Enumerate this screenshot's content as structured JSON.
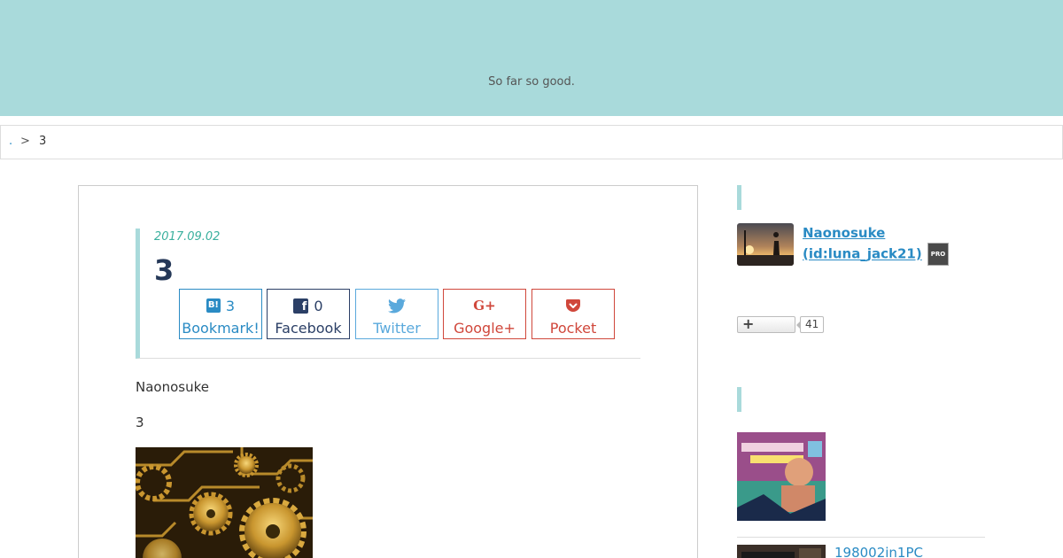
{
  "header": {
    "tagline": "So far so good."
  },
  "breadcrumb": {
    "home_label": ".",
    "separator": ">",
    "current": "3"
  },
  "entry": {
    "date": "2017.09.02",
    "title": "3",
    "author": "Naonosuke",
    "body_text": "3",
    "share": {
      "hatena": {
        "icon": "hatena-bookmark-icon",
        "count": "3",
        "label": "Bookmark!"
      },
      "facebook": {
        "icon": "facebook-icon",
        "count": "0",
        "label": "Facebook"
      },
      "twitter": {
        "icon": "twitter-bird-icon",
        "label": "Twitter"
      },
      "google": {
        "icon": "google-plus-icon",
        "label": "Google+"
      },
      "pocket": {
        "icon": "pocket-icon",
        "label": "Pocket"
      }
    }
  },
  "sidebar": {
    "profile": {
      "name_line1": "Naonosuke",
      "name_line2": "(id:luna_jack21)",
      "badge": "PRO"
    },
    "follow": {
      "icon": "plus-icon",
      "count": "41"
    },
    "recent": {
      "item2_title": "198002in1PC"
    }
  },
  "colors": {
    "header_bg": "#a9dadb",
    "accent_blue": "#2a8bc4",
    "date_green": "#3ab09e",
    "title_navy": "#253858",
    "facebook": "#2b3f66",
    "twitter": "#5aa9dc",
    "google_pocket_red": "#d0473b"
  }
}
